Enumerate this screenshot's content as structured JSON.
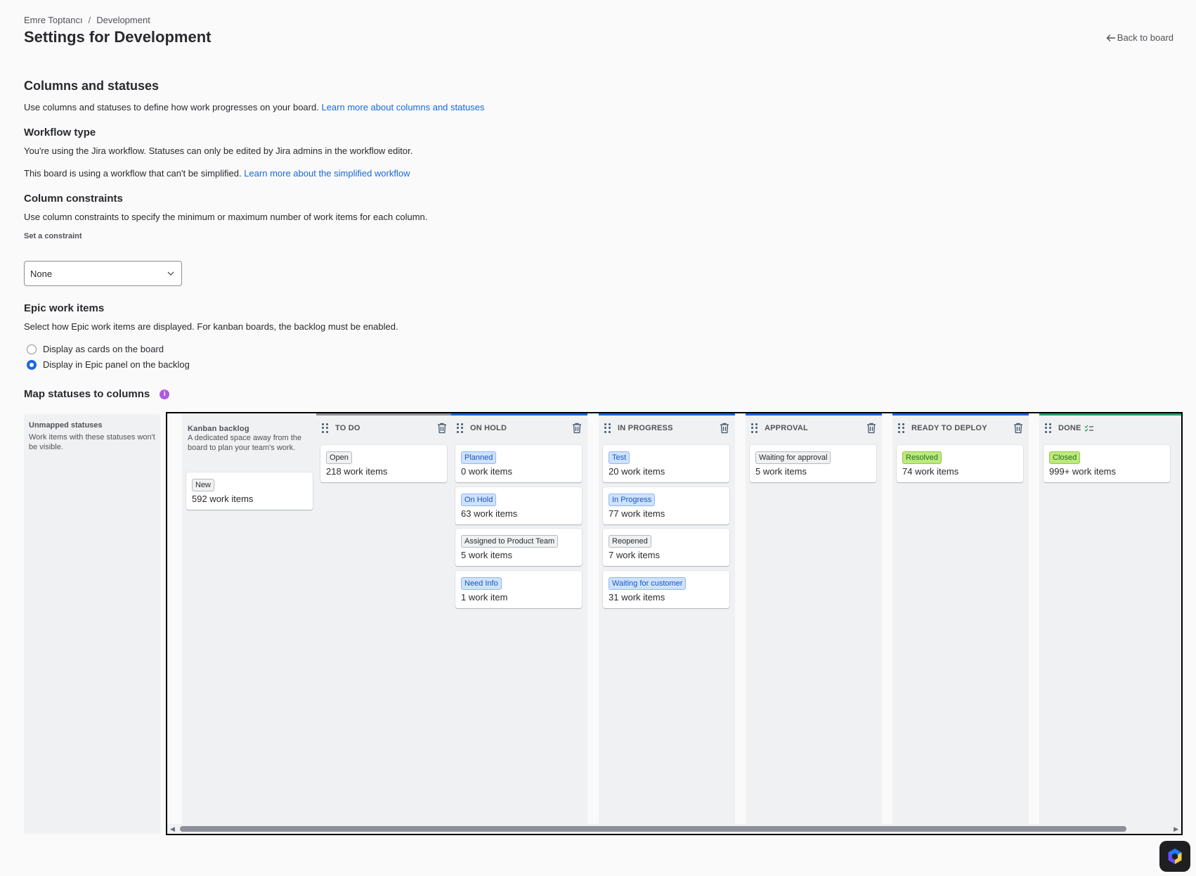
{
  "breadcrumb": {
    "parent": "Emre Toptancı",
    "separator": "/",
    "current": "Development"
  },
  "page": {
    "title": "Settings for Development",
    "back_label": "Back to board"
  },
  "columns_section": {
    "title": "Columns and statuses",
    "description": "Use columns and statuses to define how work progresses on your board.",
    "link": "Learn more about columns and statuses"
  },
  "workflow": {
    "title": "Workflow type",
    "description": "You're using the Jira workflow. Statuses can only be edited by Jira admins in the workflow editor.",
    "note": "This board is using a workflow that can't be simplified.",
    "link": "Learn more about the simplified workflow"
  },
  "constraints": {
    "title": "Column constraints",
    "description": "Use column constraints to specify the minimum or maximum number of work items for each column.",
    "label": "Set a constraint",
    "value": "None"
  },
  "epic": {
    "title": "Epic work items",
    "description": "Select how Epic work items are displayed. For kanban boards, the backlog must be enabled.",
    "options": [
      {
        "label": "Display as cards on the board",
        "checked": false
      },
      {
        "label": "Display in Epic panel on the backlog",
        "checked": true
      }
    ]
  },
  "map": {
    "title": "Map statuses to columns",
    "info_glyph": "i",
    "unmapped": {
      "title": "Unmapped statuses",
      "description": "Work items with these statuses won't be visible."
    },
    "backlog": {
      "title": "Kanban backlog",
      "description": "A dedicated space away from the board to plan your team's work.",
      "cards": [
        {
          "status": "New",
          "count": "592 work items"
        }
      ]
    },
    "columns": [
      {
        "name": "TO DO",
        "cards": [
          {
            "status": "Open",
            "count": "218 work items",
            "tone": "grey"
          }
        ]
      },
      {
        "name": "ON HOLD",
        "cards": [
          {
            "status": "Planned",
            "count": "0 work items",
            "tone": "blue"
          },
          {
            "status": "On Hold",
            "count": "63 work items",
            "tone": "blue"
          },
          {
            "status": "Assigned to Product Team",
            "count": "5 work items",
            "tone": "grey"
          },
          {
            "status": "Need Info",
            "count": "1 work item",
            "tone": "blue"
          }
        ]
      },
      {
        "name": "IN PROGRESS",
        "cards": [
          {
            "status": "Test",
            "count": "20 work items",
            "tone": "blue"
          },
          {
            "status": "In Progress",
            "count": "77 work items",
            "tone": "blue"
          },
          {
            "status": "Reopened",
            "count": "7 work items",
            "tone": "grey"
          },
          {
            "status": "Waiting for customer",
            "count": "31 work items",
            "tone": "blue"
          }
        ]
      },
      {
        "name": "APPROVAL",
        "cards": [
          {
            "status": "Waiting for approval",
            "count": "5 work items",
            "tone": "grey"
          }
        ]
      },
      {
        "name": "READY TO DEPLOY",
        "cards": [
          {
            "status": "Resolved",
            "count": "74 work items",
            "tone": "green"
          }
        ]
      },
      {
        "name": "DONE",
        "cards": [
          {
            "status": "Closed",
            "count": "999+ work items",
            "tone": "green"
          }
        ]
      }
    ]
  },
  "colors": {
    "link": "#1868db",
    "accent_blue": "#1868db",
    "done_green": "#22a06b",
    "info_purple": "#af59e1"
  },
  "icons": [
    "arrow-left-icon",
    "chevron-down-icon",
    "info-icon",
    "drag-handle-icon",
    "trash-icon",
    "done-checklist-icon",
    "assistant-icon"
  ]
}
